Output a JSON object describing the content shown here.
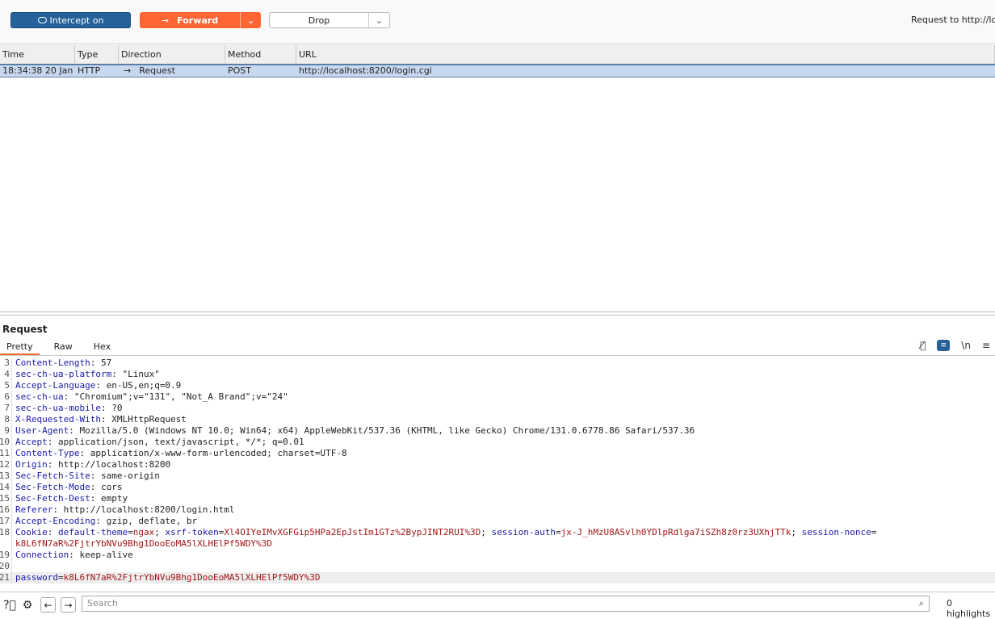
{
  "toolbar": {
    "intercept_label": "Intercept on",
    "forward_label": "Forward",
    "drop_label": "Drop",
    "request_to": "Request to http://loca"
  },
  "table": {
    "headers": [
      "Time",
      "Type",
      "Direction",
      "Method",
      "URL"
    ],
    "rows": [
      {
        "time": "18:34:38 20 Jan ...",
        "type": "HTTP",
        "direction": "Request",
        "method": "POST",
        "url": "http://localhost:8200/login.cgi"
      }
    ]
  },
  "panel": {
    "title": "Request",
    "tabs": [
      "Pretty",
      "Raw",
      "Hex"
    ],
    "active_tab": "Pretty",
    "wrap_toggle_label": "\\n"
  },
  "editor": {
    "lines": [
      {
        "n": "3",
        "segs": [
          [
            "k",
            "Content-Length"
          ],
          [
            "p",
            ": 57"
          ]
        ]
      },
      {
        "n": "4",
        "segs": [
          [
            "k",
            "sec-ch-ua-platform"
          ],
          [
            "p",
            ": \"Linux\""
          ]
        ]
      },
      {
        "n": "5",
        "segs": [
          [
            "k",
            "Accept-Language"
          ],
          [
            "p",
            ": en-US,en;q=0.9"
          ]
        ]
      },
      {
        "n": "6",
        "segs": [
          [
            "k",
            "sec-ch-ua"
          ],
          [
            "p",
            ": \"Chromium\";v=\"131\", \"Not_A Brand\";v=\"24\""
          ]
        ]
      },
      {
        "n": "7",
        "segs": [
          [
            "k",
            "sec-ch-ua-mobile"
          ],
          [
            "p",
            ": ?0"
          ]
        ]
      },
      {
        "n": "8",
        "segs": [
          [
            "k",
            "X-Requested-With"
          ],
          [
            "p",
            ": XMLHttpRequest"
          ]
        ]
      },
      {
        "n": "9",
        "segs": [
          [
            "k",
            "User-Agent"
          ],
          [
            "p",
            ": Mozilla/5.0 (Windows NT 10.0; Win64; x64) AppleWebKit/537.36 (KHTML, like Gecko) Chrome/131.0.6778.86 Safari/537.36"
          ]
        ]
      },
      {
        "n": "10",
        "segs": [
          [
            "k",
            "Accept"
          ],
          [
            "p",
            ": application/json, text/javascript, */*; q=0.01"
          ]
        ]
      },
      {
        "n": "11",
        "segs": [
          [
            "k",
            "Content-Type"
          ],
          [
            "p",
            ": application/x-www-form-urlencoded; charset=UTF-8"
          ]
        ]
      },
      {
        "n": "12",
        "segs": [
          [
            "k",
            "Origin"
          ],
          [
            "p",
            ": http://localhost:8200"
          ]
        ]
      },
      {
        "n": "13",
        "segs": [
          [
            "k",
            "Sec-Fetch-Site"
          ],
          [
            "p",
            ": same-origin"
          ]
        ]
      },
      {
        "n": "14",
        "segs": [
          [
            "k",
            "Sec-Fetch-Mode"
          ],
          [
            "p",
            ": cors"
          ]
        ]
      },
      {
        "n": "15",
        "segs": [
          [
            "k",
            "Sec-Fetch-Dest"
          ],
          [
            "p",
            ": empty"
          ]
        ]
      },
      {
        "n": "16",
        "segs": [
          [
            "k",
            "Referer"
          ],
          [
            "p",
            ": http://localhost:8200/login.html"
          ]
        ]
      },
      {
        "n": "17",
        "segs": [
          [
            "k",
            "Accept-Encoding"
          ],
          [
            "p",
            ": gzip, deflate, br"
          ]
        ]
      },
      {
        "n": "18",
        "segs": [
          [
            "k",
            "Cookie"
          ],
          [
            "p",
            ": "
          ],
          [
            "k",
            "default-theme"
          ],
          [
            "p",
            "="
          ],
          [
            "v",
            "ngax"
          ],
          [
            "p",
            "; "
          ],
          [
            "k",
            "xsrf-token"
          ],
          [
            "p",
            "="
          ],
          [
            "v",
            "Xl4OIYeIMvXGFGip5HPa2EpJstIm1GTz%2BypJINT2RUI%3D"
          ],
          [
            "p",
            "; "
          ],
          [
            "k",
            "session-auth"
          ],
          [
            "p",
            "="
          ],
          [
            "v",
            "jx-J_hMzU8ASvlh0YDlpRdlga7iSZh8z0rz3UXhjTTk"
          ],
          [
            "p",
            "; "
          ],
          [
            "k",
            "session-nonce"
          ],
          [
            "p",
            "="
          ]
        ]
      },
      {
        "n": "",
        "segs": [
          [
            "v",
            "k8L6fN7aR%2FjtrYbNVu9Bhg1DooEoMA5lXLHElPf5WDY%3D"
          ]
        ]
      },
      {
        "n": "19",
        "segs": [
          [
            "k",
            "Connection"
          ],
          [
            "p",
            ": keep-alive"
          ]
        ]
      },
      {
        "n": "20",
        "segs": []
      },
      {
        "n": "21",
        "hl": true,
        "segs": [
          [
            "k",
            "password"
          ],
          [
            "p",
            "="
          ],
          [
            "v",
            "k8L6fN7aR%2FjtrYbNVu9Bhg1DooEoMA5lXLHElPf5WDY%3D"
          ]
        ]
      }
    ]
  },
  "bottom": {
    "search_placeholder": "Search",
    "highlights": "0 highlights"
  },
  "colors": {
    "accent": "#ff6633",
    "intercept": "#26619a",
    "selected_row": "#c8d8ef",
    "header_key": "#1a1aa6",
    "value": "#a31515"
  }
}
